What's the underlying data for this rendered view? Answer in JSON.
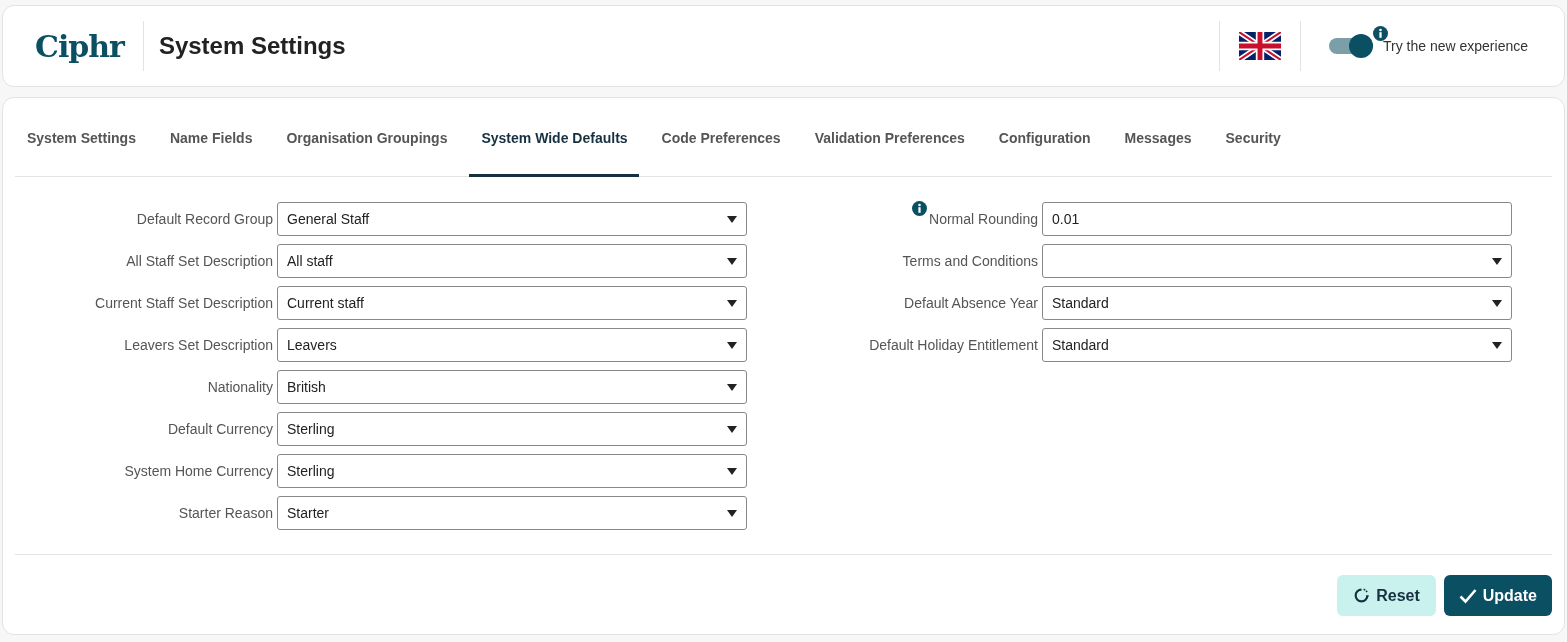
{
  "header": {
    "logo": "Ciphr",
    "title": "System Settings",
    "toggle": {
      "label": "Try the new experience",
      "on": true
    }
  },
  "tabs": [
    {
      "label": "System Settings",
      "selected": false
    },
    {
      "label": "Name Fields",
      "selected": false
    },
    {
      "label": "Organisation Groupings",
      "selected": false
    },
    {
      "label": "System Wide Defaults",
      "selected": true
    },
    {
      "label": "Code Preferences",
      "selected": false
    },
    {
      "label": "Validation Preferences",
      "selected": false
    },
    {
      "label": "Configuration",
      "selected": false
    },
    {
      "label": "Messages",
      "selected": false
    },
    {
      "label": "Security",
      "selected": false
    }
  ],
  "left_fields": [
    {
      "label": "Default Record Group",
      "kind": "select",
      "value": "General Staff"
    },
    {
      "label": "All Staff Set Description",
      "kind": "select",
      "value": "All staff"
    },
    {
      "label": "Current Staff Set Description",
      "kind": "select",
      "value": "Current staff"
    },
    {
      "label": "Leavers Set Description",
      "kind": "select",
      "value": "Leavers"
    },
    {
      "label": "Nationality",
      "kind": "select",
      "value": "British"
    },
    {
      "label": "Default Currency",
      "kind": "select",
      "value": "Sterling"
    },
    {
      "label": "System Home Currency",
      "kind": "select",
      "value": "Sterling"
    },
    {
      "label": "Starter Reason",
      "kind": "select",
      "value": "Starter"
    }
  ],
  "right_fields": [
    {
      "label": "Normal Rounding",
      "kind": "text",
      "value": "0.01",
      "info": true
    },
    {
      "label": "Terms and Conditions",
      "kind": "select"
    },
    {
      "label": "Default Absence Year",
      "kind": "select",
      "value": "Standard"
    },
    {
      "label": "Default Holiday Entitlement",
      "kind": "select",
      "value": "Standard"
    }
  ],
  "buttons": [
    {
      "label": "Reset",
      "kind": "reset"
    },
    {
      "label": "Update",
      "kind": "update"
    }
  ]
}
